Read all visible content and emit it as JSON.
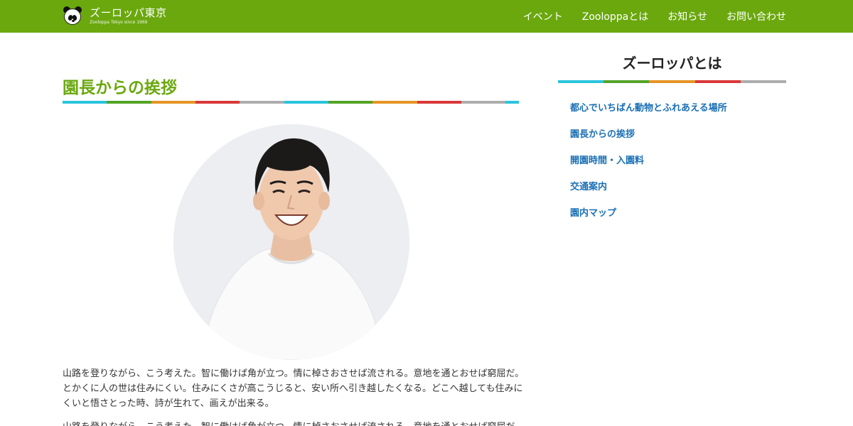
{
  "header": {
    "site_title": "ズーロッパ東京",
    "site_subtitle": "Zooloppa Tokyo since 1969",
    "logo_icon": "panda-icon",
    "nav": [
      {
        "label": "イベント"
      },
      {
        "label": "Zooloppaとは"
      },
      {
        "label": "お知らせ"
      },
      {
        "label": "お問い合わせ"
      }
    ]
  },
  "colors": {
    "brand": "#6aa80e",
    "link": "#1a6fb5",
    "strip": [
      "#2ac4dd",
      "#54a327",
      "#e69425",
      "#d93838",
      "#adadad"
    ]
  },
  "main": {
    "title": "園長からの挨拶",
    "photo_alt": "smiling-man-photo",
    "paragraphs": [
      "山路を登りながら、こう考えた。智に働けば角が立つ。情に棹さおさせば流される。意地を通とおせば窮屈だ。とかくに人の世は住みにくい。住みにくさが高こうじると、安い所へ引き越したくなる。どこへ越しても住みにくいと悟さとった時、詩が生れて、画えが出来る。",
      "山路を登りながら、こう考えた。智に働けば角が立つ。情に棹さおさせば流される。意地を通とおせば窮屈だ。"
    ]
  },
  "sidebar": {
    "title": "ズーロッパとは",
    "items": [
      {
        "label": "都心でいちばん動物とふれあえる場所"
      },
      {
        "label": "園長からの挨拶"
      },
      {
        "label": "開園時間・入園料"
      },
      {
        "label": "交通案内"
      },
      {
        "label": "園内マップ"
      }
    ]
  }
}
